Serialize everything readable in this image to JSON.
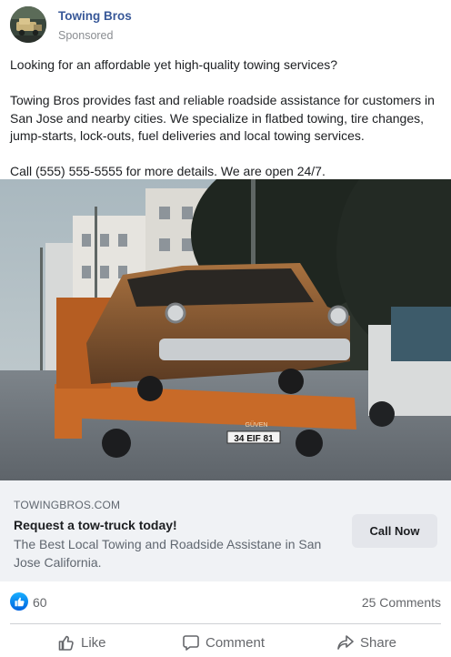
{
  "header": {
    "page_name": "Towing Bros",
    "sponsored": "Sponsored",
    "avatar_icon": "tow-truck-icon"
  },
  "post": {
    "line1": "Looking for an affordable yet high-quality towing services?",
    "para2_line1": "Towing Bros provides fast and reliable roadside assistance for customers in",
    "para2_line2": "San Jose and nearby cities. We specialize in flatbed towing, tire changes,",
    "para2_line3": "jump-starts, lock-outs, fuel deliveries and local towing services.",
    "line4": "Call (555) 555-5555 for more details. We are open 24/7."
  },
  "image": {
    "plate_text": "34 EIF 81",
    "truck_text": "GÜVEN"
  },
  "link_card": {
    "domain": "TOWINGBROS.COM",
    "headline": "Request a tow-truck today!",
    "description_line1": "The Best Local Towing and Roadside Assistane in San",
    "description_line2": "Jose California.",
    "cta_label": "Call Now"
  },
  "reactions": {
    "like_count": "60",
    "comments": "25 Comments"
  },
  "actions": {
    "like": "Like",
    "comment": "Comment",
    "share": "Share"
  },
  "colors": {
    "brand_link": "#385898",
    "like_blue": "#0866ff",
    "card_bg": "#f0f2f5",
    "button_bg": "#e4e6eb"
  }
}
